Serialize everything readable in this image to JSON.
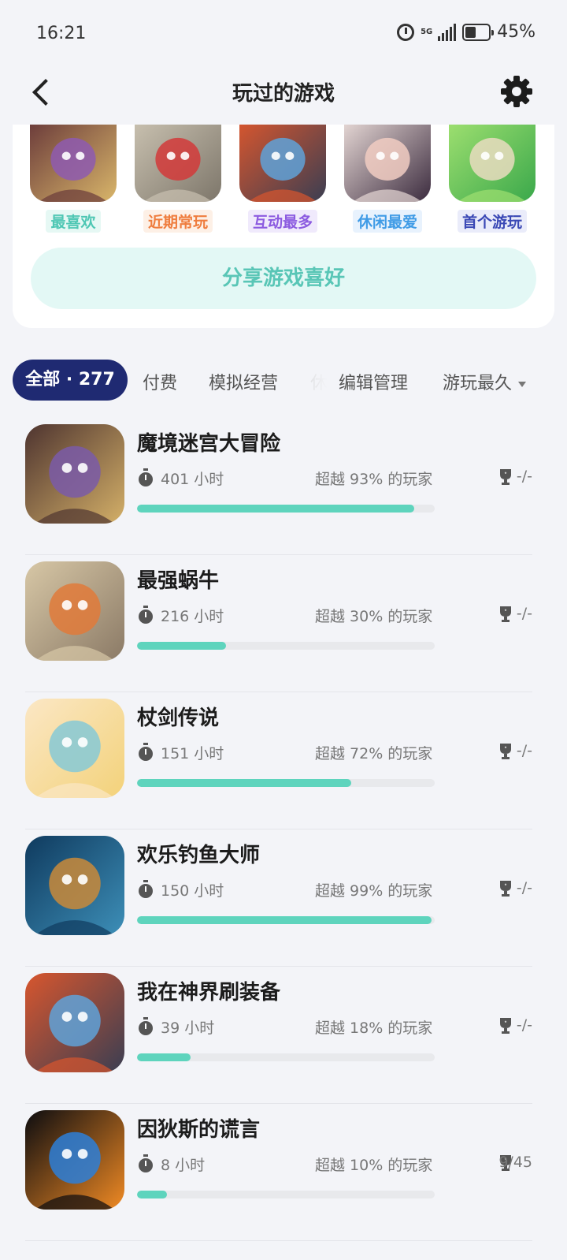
{
  "status": {
    "time": "16:21",
    "network": "5G",
    "battery": "45%",
    "battery_level": 0.45
  },
  "header": {
    "title": "玩过的游戏",
    "back_icon": "chevron-left-icon",
    "settings_icon": "gear-icon"
  },
  "top_games": [
    {
      "label": "最喜欢",
      "label_color": "#4fc7b4",
      "label_bg": "#e6f8f4",
      "art": [
        "#6a3a3a",
        "#d9b66a",
        "#8e5ab0"
      ]
    },
    {
      "label": "近期常玩",
      "label_color": "#ef7d3e",
      "label_bg": "#fdf0e6",
      "art": [
        "#c9c1b0",
        "#7d766a",
        "#d23a3a"
      ]
    },
    {
      "label": "互动最多",
      "label_color": "#8c5be0",
      "label_bg": "#f0eafc",
      "art": [
        "#d8562e",
        "#3a3e52",
        "#5fa2d8"
      ]
    },
    {
      "label": "休闲最爱",
      "label_color": "#3f9be6",
      "label_bg": "#e8f2fd",
      "art": [
        "#e7d9d6",
        "#3b2b3e",
        "#f1ccc2"
      ]
    },
    {
      "label": "首个游玩",
      "label_color": "#3a48b5",
      "label_bg": "#eaecfa",
      "art": [
        "#9fe070",
        "#3aa84b",
        "#e9dcc0"
      ]
    }
  ],
  "share_label": "分享游戏喜好",
  "filters": {
    "all_label": "全部 · 277",
    "tabs": [
      "付费",
      "模拟经营",
      "休"
    ],
    "manage_label": "编辑管理",
    "sort_label": "游玩最久"
  },
  "games": [
    {
      "name": "魔境迷宫大冒险",
      "hours": "401 小时",
      "beat": "超越 93% 的玩家",
      "achievements": "-/-",
      "progress": 0.93,
      "art": [
        "#4e3430",
        "#d4b068",
        "#7a5aa8"
      ]
    },
    {
      "name": "最强蜗牛",
      "hours": "216 小时",
      "beat": "超越 30% 的玩家",
      "achievements": "-/-",
      "progress": 0.3,
      "art": [
        "#d7c7a6",
        "#8b7a66",
        "#e07a3a"
      ]
    },
    {
      "name": "杖剑传说",
      "hours": "151 小时",
      "beat": "超越 72% 的玩家",
      "achievements": "-/-",
      "progress": 0.72,
      "art": [
        "#fbe7c5",
        "#f3d27a",
        "#86c9d6"
      ]
    },
    {
      "name": "欢乐钓鱼大师",
      "hours": "150 小时",
      "beat": "超越 99% 的玩家",
      "achievements": "-/-",
      "progress": 0.99,
      "art": [
        "#0f3a5e",
        "#3d8fb8",
        "#c98a3a"
      ]
    },
    {
      "name": "我在神界刷装备",
      "hours": "39 小时",
      "beat": "超越 18% 的玩家",
      "achievements": "-/-",
      "progress": 0.18,
      "art": [
        "#d8562e",
        "#3a3e52",
        "#5fa2d8"
      ]
    },
    {
      "name": "因狄斯的谎言",
      "hours": "8 小时",
      "beat": "超越 10% 的玩家",
      "achievements": "9/45",
      "progress": 0.1,
      "art": [
        "#0c0c10",
        "#f08a24",
        "#2d7fd8"
      ]
    }
  ],
  "colors": {
    "accent": "#5ed4bd",
    "chip": "#1f2a72",
    "share_bg": "#e3f8f5"
  }
}
